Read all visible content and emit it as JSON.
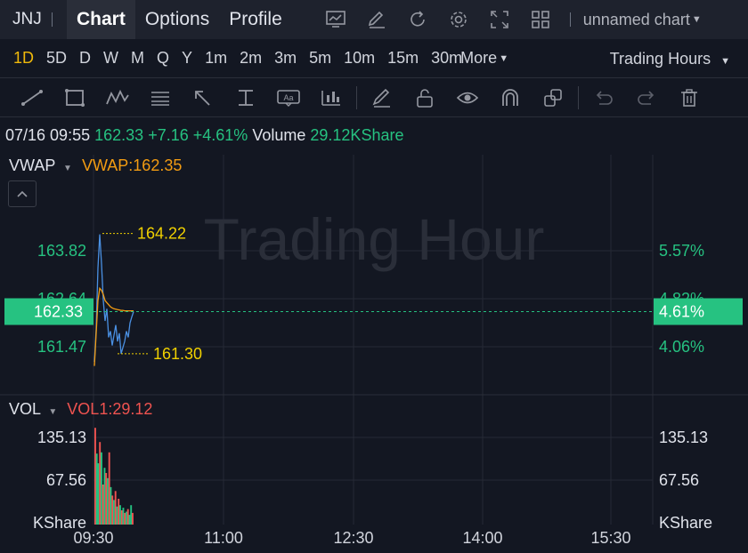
{
  "header": {
    "ticker": "JNJ",
    "tabs": [
      {
        "label": "Chart",
        "active": true
      },
      {
        "label": "Options",
        "active": false
      },
      {
        "label": "Profile",
        "active": false
      }
    ],
    "icons": [
      "chart-screen-icon",
      "edit-icon",
      "refresh-icon",
      "settings-icon",
      "fullscreen-icon",
      "layout-grid-icon"
    ],
    "chart_name": "unnamed chart"
  },
  "periods": {
    "items": [
      "1D",
      "5D",
      "D",
      "W",
      "M",
      "Q",
      "Y",
      "1m",
      "2m",
      "3m",
      "5m",
      "10m",
      "15m",
      "30m"
    ],
    "active": "1D",
    "more_label": "More",
    "trading_hours_label": "Trading Hours"
  },
  "drawing_tools": [
    "trendline-icon",
    "rectangle-icon",
    "pattern-icon",
    "fib-icon",
    "arrow-icon",
    "measure-icon",
    "text-icon",
    "chart-indicator-icon",
    "pen-icon",
    "lock-icon",
    "eye-icon",
    "magnet-icon",
    "clone-icon",
    "undo-icon",
    "redo-icon",
    "trash-icon"
  ],
  "info": {
    "datetime": "07/16 09:55",
    "price": "162.33",
    "change": "+7.16",
    "change_pct": "+4.61%",
    "volume_label": "Volume",
    "volume_value": "29.12KShare"
  },
  "indicators": {
    "vwap_name": "VWAP",
    "vwap_value": "VWAP:162.35",
    "vol_name": "VOL",
    "vol_value": "VOL1:29.12"
  },
  "watermark": "Trading Hour",
  "colors": {
    "up": "#26c281",
    "down": "#ef5350",
    "price_line": "#4a90e2",
    "vwap_line": "#f39c12",
    "highlight": "#f0d000",
    "background": "#131722"
  },
  "chart_data": {
    "type": "line",
    "price_axis": {
      "left_ticks": [
        "163.82",
        "162.64",
        "161.47"
      ],
      "right_ticks": [
        "5.57%",
        "4.82%",
        "4.06%"
      ],
      "current_price": "162.33",
      "current_pct": "4.61%"
    },
    "annotations": {
      "high": "164.22",
      "low": "161.30"
    },
    "x_ticks": [
      "09:30",
      "11:00",
      "12:30",
      "14:00",
      "15:30"
    ],
    "series": [
      {
        "name": "Price",
        "values": [
          161.1,
          161.9,
          163.4,
          164.22,
          163.5,
          162.6,
          162.1,
          162.4,
          161.7,
          161.85,
          161.5,
          161.75,
          162.0,
          161.6,
          161.8,
          161.3,
          161.45,
          161.6,
          161.85,
          161.7,
          162.05,
          162.2,
          162.33
        ]
      },
      {
        "name": "VWAP",
        "values": [
          161.0,
          161.8,
          162.6,
          162.9,
          162.85,
          162.75,
          162.6,
          162.55,
          162.5,
          162.45,
          162.42,
          162.4,
          162.39,
          162.38,
          162.37,
          162.36,
          162.36,
          162.35,
          162.35,
          162.35,
          162.35,
          162.35,
          162.35
        ]
      }
    ],
    "volume": {
      "ticks_left": [
        "135.13",
        "67.56"
      ],
      "ticks_right": [
        "135.13",
        "67.56"
      ],
      "unit": "KShare",
      "bars": [
        {
          "v": 150,
          "up": false
        },
        {
          "v": 110,
          "up": true
        },
        {
          "v": 95,
          "up": true
        },
        {
          "v": 128,
          "up": false
        },
        {
          "v": 112,
          "up": true
        },
        {
          "v": 62,
          "up": false
        },
        {
          "v": 88,
          "up": true
        },
        {
          "v": 80,
          "up": false
        },
        {
          "v": 72,
          "up": true
        },
        {
          "v": 112,
          "up": false
        },
        {
          "v": 58,
          "up": true
        },
        {
          "v": 45,
          "up": false
        },
        {
          "v": 38,
          "up": true
        },
        {
          "v": 52,
          "up": false
        },
        {
          "v": 28,
          "up": true
        },
        {
          "v": 40,
          "up": false
        },
        {
          "v": 30,
          "up": true
        },
        {
          "v": 22,
          "up": false
        },
        {
          "v": 26,
          "up": true
        },
        {
          "v": 18,
          "up": false
        },
        {
          "v": 20,
          "up": true
        },
        {
          "v": 24,
          "up": false
        },
        {
          "v": 15,
          "up": true
        },
        {
          "v": 30,
          "up": true
        },
        {
          "v": 18,
          "up": false
        }
      ]
    }
  }
}
